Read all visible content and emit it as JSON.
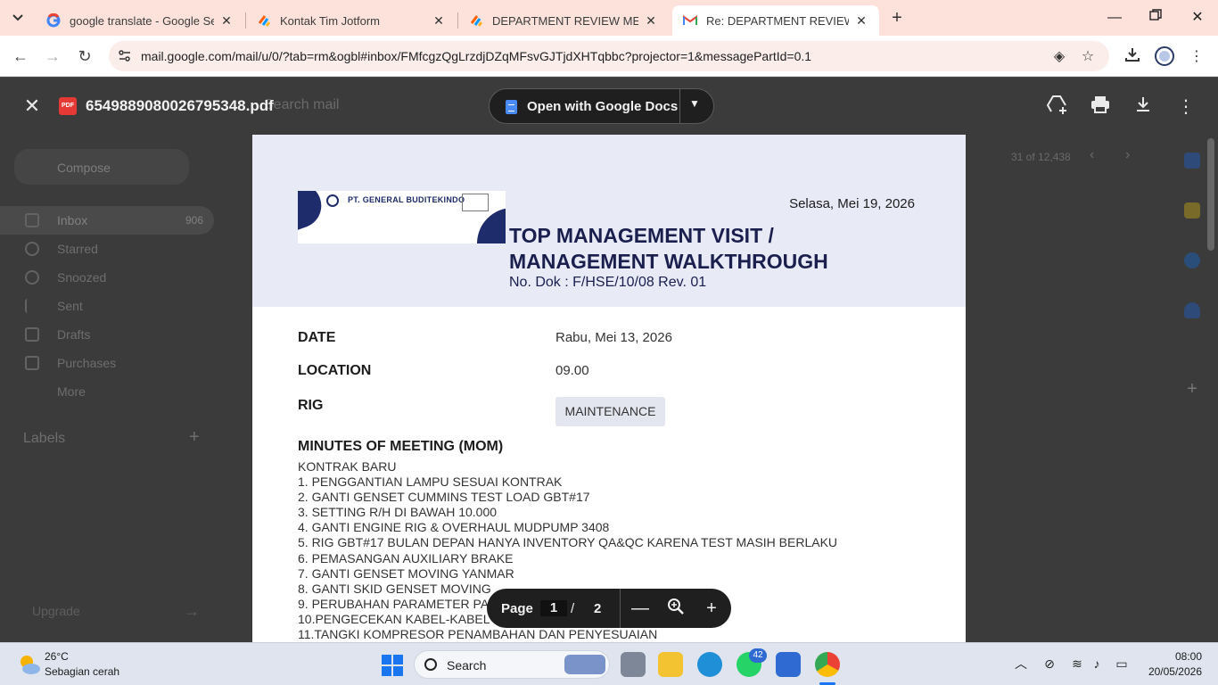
{
  "browser": {
    "tabs": [
      {
        "title": "google translate - Google Search",
        "icon": "google-g-icon",
        "active": false
      },
      {
        "title": "Kontak Tim Jotform",
        "icon": "jotform-icon",
        "active": false
      },
      {
        "title": "DEPARTMENT REVIEW MEETING",
        "icon": "jotform-icon",
        "active": false
      },
      {
        "title": "Re: DEPARTMENT REVIEW MEETING",
        "icon": "gmail-icon",
        "active": true
      }
    ],
    "url": "mail.google.com/mail/u/0/?tab=rm&ogbl#inbox/FMfcgzQgLrzdjDZqMFsvGJTjdXHTqbbc?projector=1&messagePartId=0.1"
  },
  "gmail": {
    "search_placeholder": "Search mail",
    "compose_label": "Compose",
    "nav": [
      {
        "label": "Inbox",
        "count": "906"
      },
      {
        "label": "Starred",
        "count": ""
      },
      {
        "label": "Snoozed",
        "count": ""
      },
      {
        "label": "Sent",
        "count": ""
      },
      {
        "label": "Drafts",
        "count": ""
      },
      {
        "label": "Purchases",
        "count": ""
      },
      {
        "label": "More",
        "count": ""
      }
    ],
    "labels_heading": "Labels",
    "upgrade_label": "Upgrade",
    "pagination": "31 of 12,438"
  },
  "pdf_viewer": {
    "file_name": "6549889080026795348.pdf",
    "open_with_label": "Open with Google Docs",
    "page_label": "Page",
    "current_page": "1",
    "page_separator": "/",
    "total_pages": "2"
  },
  "document": {
    "company_name": "PT. GENERAL BUDITEKINDO",
    "header_date": "Selasa, Mei 19, 2026",
    "title_line1": "TOP MANAGEMENT VISIT /",
    "title_line2": "MANAGEMENT WALKTHROUGH",
    "doc_number": "No. Dok : F/HSE/10/08 Rev. 01",
    "fields": {
      "date_label": "DATE",
      "date_value": "Rabu, Mei 13, 2026",
      "location_label": "LOCATION",
      "location_value": "09.00",
      "rig_label": "RIG",
      "rig_value": "MAINTENANCE"
    },
    "mom_title": "MINUTES OF MEETING (MOM)",
    "mom_body": "KONTRAK BARU\n1. PENGGANTIAN LAMPU SESUAI KONTRAK\n2. GANTI GENSET CUMMINS TEST LOAD GBT#17\n3. SETTING R/H DI BAWAH 10.000\n4. GANTI ENGINE RIG & OVERHAUL MUDPUMP 3408\n5. RIG GBT#17 BULAN DEPAN HANYA INVENTORY QA&QC KARENA TEST MASIH BERLAKU\n6. PEMASANGAN AUXILIARY BRAKE\n7. GANTI GENSET MOVING YANMAR\n8. GANTI SKID GENSET MOVING\n9. PERUBAHAN PARAMETER PANEL\n10.PENGECEKAN KABEL-KABEL\n11.TANGKI KOMPRESOR PENAMBAHAN DAN PENYESUAIAN"
  },
  "taskbar": {
    "weather_temp": "26°C",
    "weather_desc": "Sebagian cerah",
    "search_label": "Search",
    "whatsapp_badge": "42",
    "time": "08:00",
    "date": "20/05/2026"
  },
  "colors": {
    "tabstrip_bg": "#fde2dc",
    "doc_header_bg": "#e8ebf6",
    "doc_title": "#1a1f4e",
    "pdf_red": "#e53935"
  }
}
